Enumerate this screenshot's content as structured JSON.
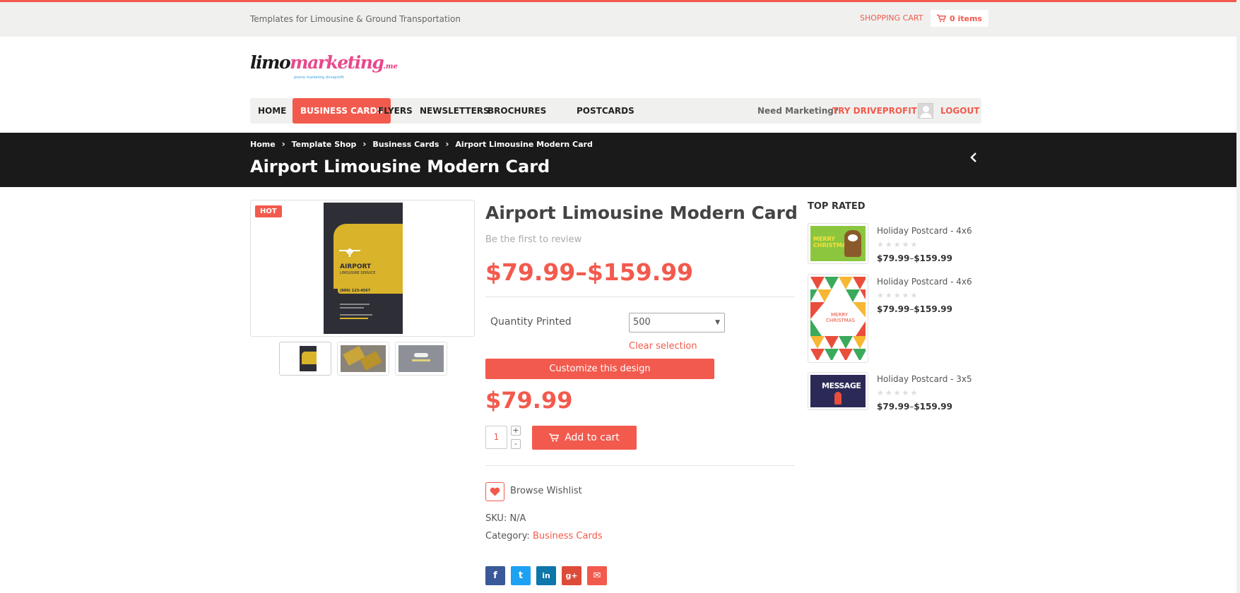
{
  "topbar": {
    "tagline": "Templates for Limousine & Ground Transportation",
    "shopping_cart": "SHOPPING CART",
    "cart_items": "0 items"
  },
  "logo": {
    "prefix": "limo",
    "accent": "marketing",
    "suffix": ".me",
    "sub": "promo marketing driveprofit"
  },
  "nav": {
    "items": [
      {
        "label": "HOME",
        "active": false
      },
      {
        "label": "BUSINESS CARDS",
        "active": true
      },
      {
        "label": "FLYERS",
        "active": false
      },
      {
        "label": "NEWSLETTERS",
        "active": false
      },
      {
        "label": "BROCHURES",
        "active": false
      },
      {
        "label": "POSTCARDS",
        "active": false
      }
    ],
    "need_marketing": "Need Marketing?",
    "try_link": "TRY DRIVEPROFIT",
    "logout": "LOGOUT"
  },
  "banner": {
    "breadcrumbs": [
      "Home",
      "Template Shop",
      "Business Cards",
      "Airport Limousine Modern Card"
    ],
    "title": "Airport Limousine Modern Card"
  },
  "product": {
    "badge": "HOT",
    "card_text": {
      "title": "AIRPORT",
      "subtitle": "LIMOUSINE SERVICE",
      "phone": "(800) 123-4567"
    },
    "title": "Airport Limousine Modern Card",
    "review_text": "Be the first to review",
    "price_low": "$79.99",
    "price_dash": "–",
    "price_high": "$159.99",
    "quantity_label": "Quantity Printed",
    "quantity_value": "500",
    "clear_selection": "Clear selection",
    "customize_label": "Customize this design",
    "price": "$79.99",
    "qty": "1",
    "plus": "+",
    "minus": "-",
    "add_to_cart": "Add to cart",
    "wishlist": "Browse Wishlist",
    "sku": "SKU: N/A",
    "category_label": "Category: ",
    "category_value": "Business Cards"
  },
  "share": [
    {
      "icon": "facebook-icon",
      "glyph": "f",
      "color": "#3b5998"
    },
    {
      "icon": "twitter-icon",
      "glyph": "t",
      "color": "#1da1f2"
    },
    {
      "icon": "linkedin-icon",
      "glyph": "in",
      "color": "#0e76a8"
    },
    {
      "icon": "google-plus-icon",
      "glyph": "g+",
      "color": "#dd4b39"
    },
    {
      "icon": "email-icon",
      "glyph": "✉",
      "color": "#f25a4d"
    }
  ],
  "sidebar": {
    "heading": "TOP RATED",
    "items": [
      {
        "name": "Holiday Postcard - 4x6",
        "stars": "★★★★★",
        "price_low": "$79.99",
        "price_dash": "–",
        "price_high": "$159.99",
        "thumb_text": "MERRY CHRISTMAS"
      },
      {
        "name": "Holiday Postcard - 4x6",
        "stars": "★★★★★",
        "price_low": "$79.99",
        "price_dash": "–",
        "price_high": "$159.99",
        "thumb_text": "MERRY CHRISTMAS"
      },
      {
        "name": "Holiday Postcard - 3x5",
        "stars": "★★★★★",
        "price_low": "$79.99",
        "price_dash": "–",
        "price_high": "$159.99",
        "thumb_text": "MESSAGE"
      }
    ]
  },
  "colors": {
    "accent": "#f25a4d",
    "banner_bg": "#1a1a1a",
    "topbar_bg": "#f0f0ee"
  }
}
